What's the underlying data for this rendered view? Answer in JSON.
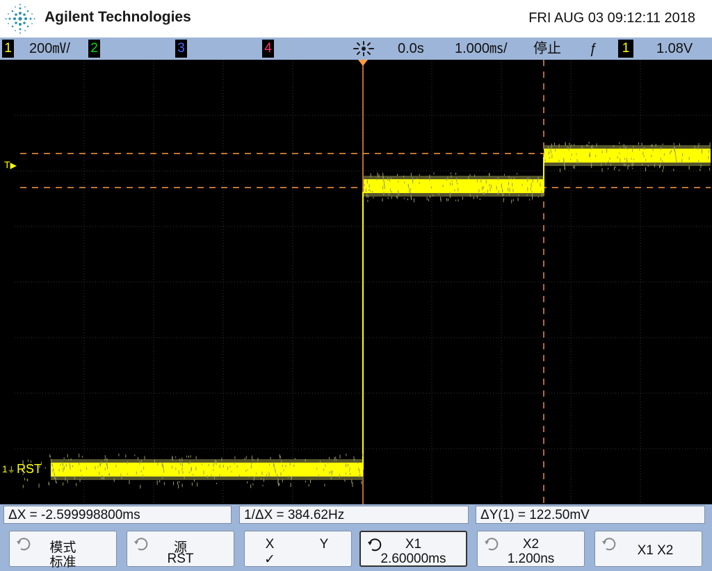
{
  "header": {
    "brand": "Agilent Technologies",
    "datetime": "FRI AUG 03 09:12:11 2018"
  },
  "status": {
    "ch1_num": "1",
    "ch1_scale": "200㎷/",
    "ch2_num": "2",
    "ch3_num": "3",
    "ch4_num": "4",
    "time_delay": "0.0s",
    "time_scale": "1.000㎳/",
    "run_state": "停止",
    "trigger_edge": "ƒ",
    "trigger_source": "1",
    "trigger_level": "1.08V",
    "colors": {
      "ch1": "#ffff00",
      "ch2": "#00dd00",
      "ch3": "#4466ff",
      "ch4": "#ff3377"
    }
  },
  "screen": {
    "channel_label": "RST",
    "trigger_marker": "T",
    "ground_marker": "1"
  },
  "measurements": {
    "delta_x": "ΔX = -2.599998800ms",
    "inv_delta_x": "1/ΔX = 384.62Hz",
    "delta_y": "ΔY(1) = 122.50mV"
  },
  "softkeys": [
    {
      "line1": "模式",
      "line2": "标准"
    },
    {
      "line1": "源",
      "line2": "RST"
    },
    {
      "line1a": "X",
      "line1b": "Y",
      "line2": "✓"
    },
    {
      "line1": "X1",
      "line2": "2.60000ms"
    },
    {
      "line1": "X2",
      "line2": "1.200ns"
    },
    {
      "line1": "X1 X2"
    }
  ]
}
